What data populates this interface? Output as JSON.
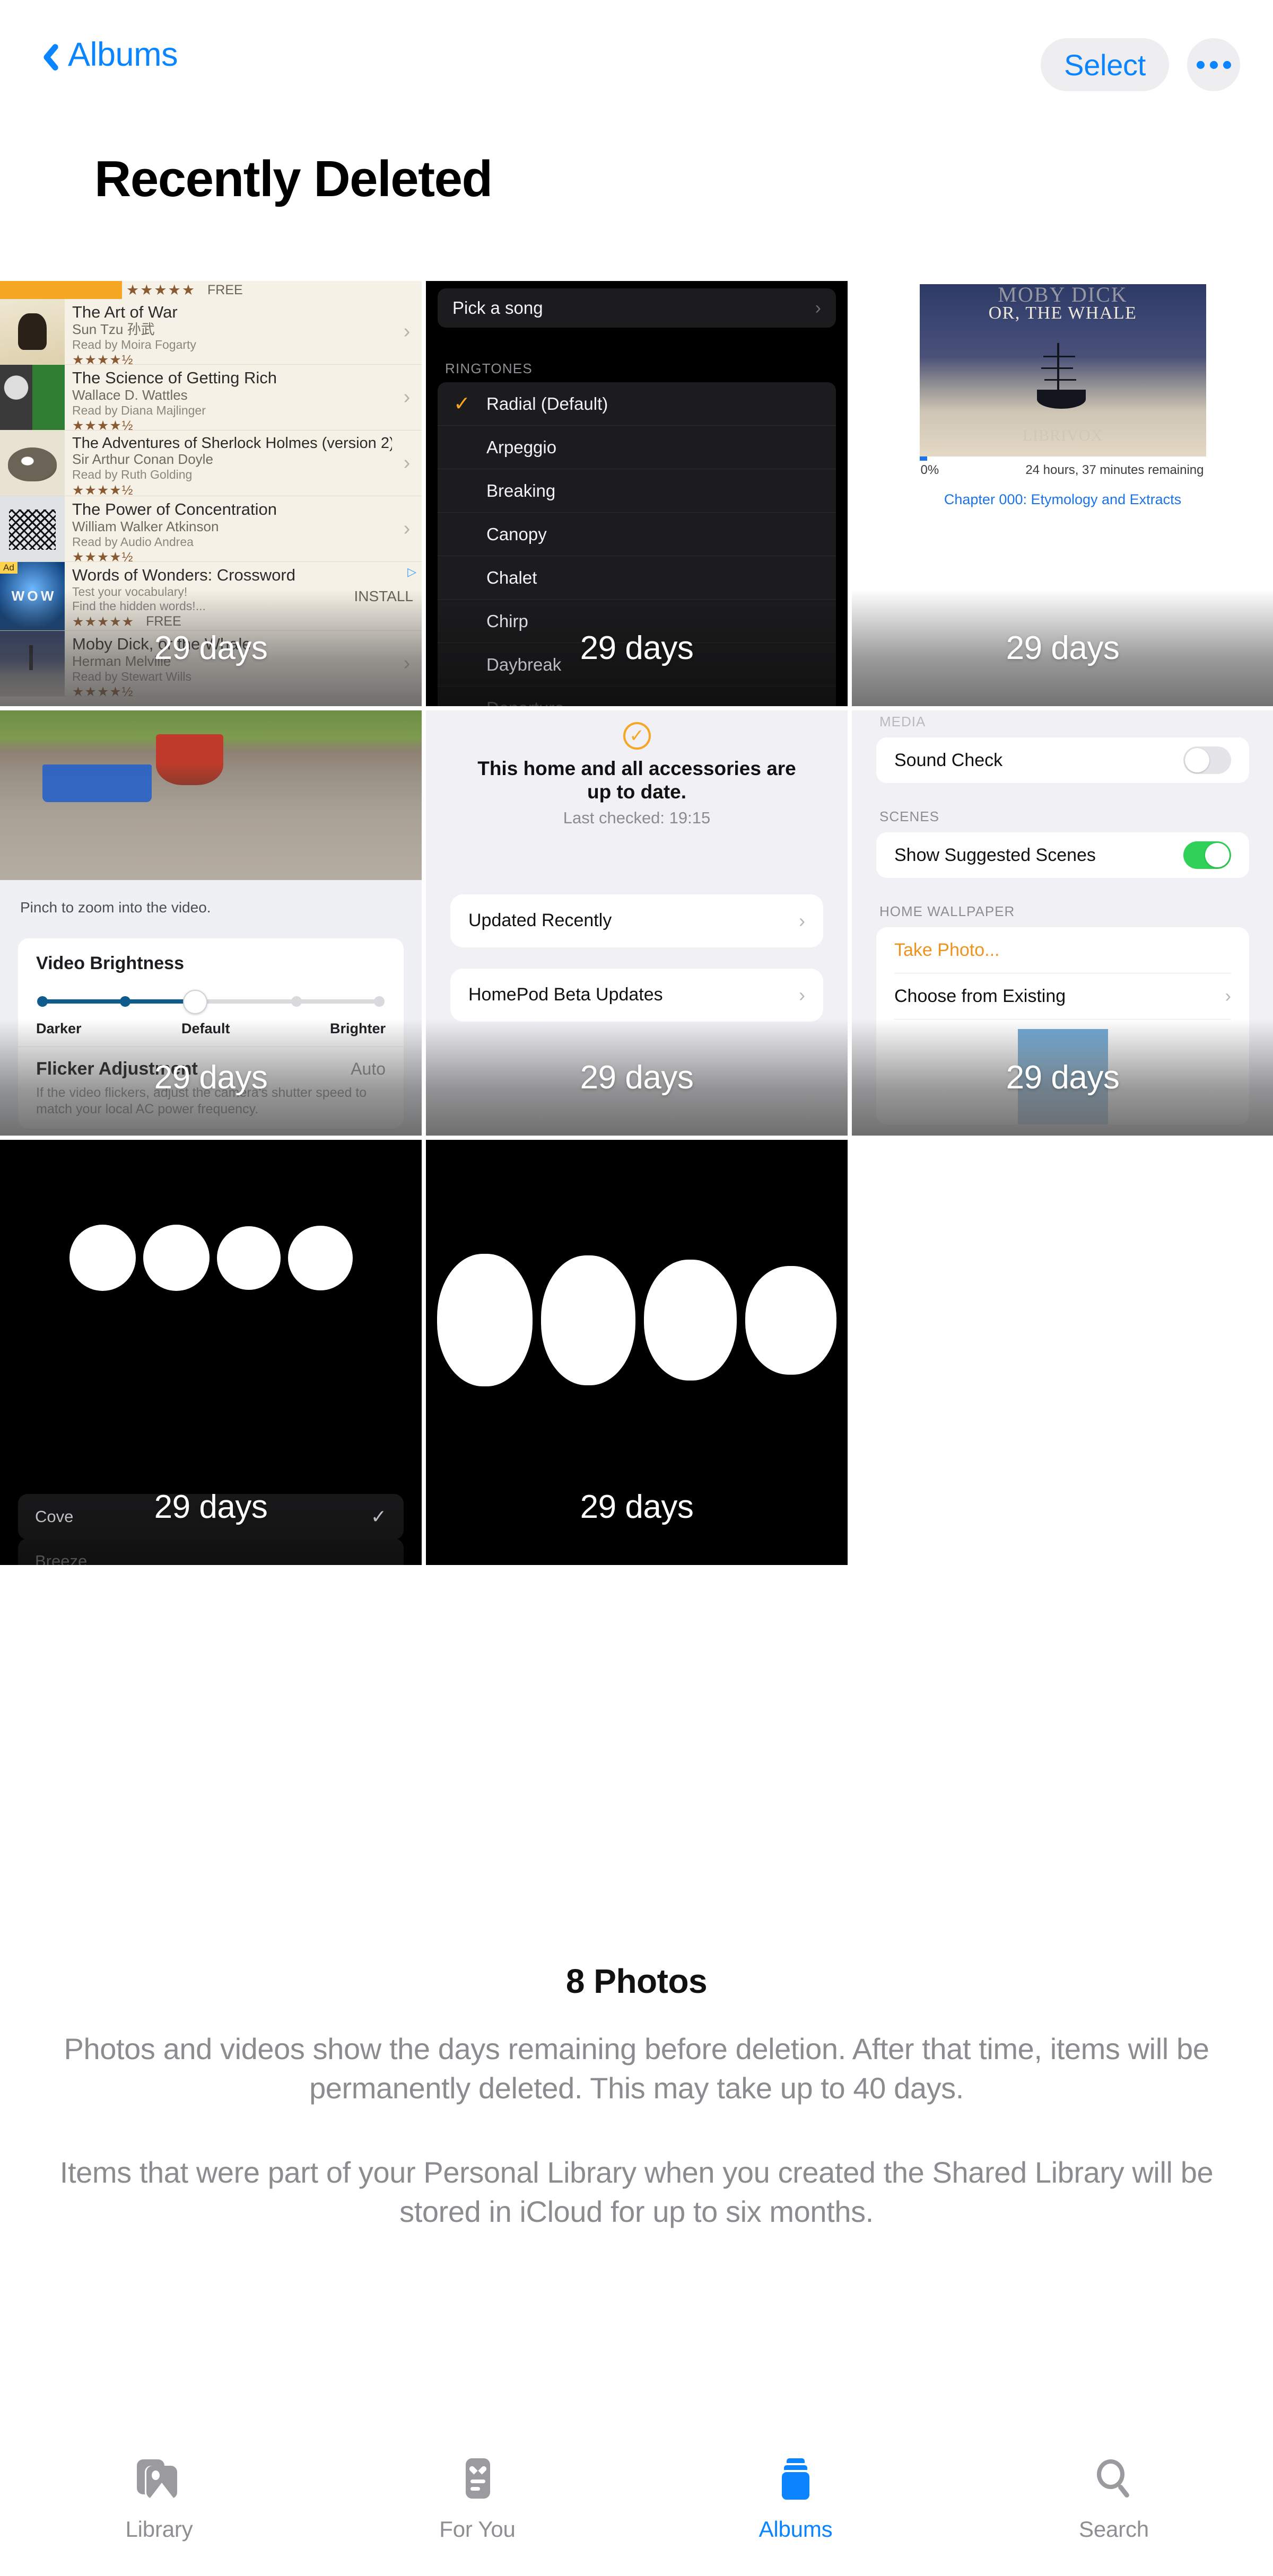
{
  "navbar": {
    "back_label": "Albums",
    "select_label": "Select",
    "more_label": "•••"
  },
  "page_title": "Recently Deleted",
  "grid": {
    "tiles": [
      {
        "id": "audiobooks",
        "days_label": "29 days",
        "kind": "audiobook-list",
        "header": {
          "stars": "★★★★★",
          "free": "FREE"
        },
        "rows": [
          {
            "title": "The Art of War",
            "author": "Sun Tzu 孙武",
            "reader": "Read by Moira Fogarty",
            "stars": "★★★★½"
          },
          {
            "title": "The Science of Getting Rich",
            "author": "Wallace D. Wattles",
            "reader": "Read by Diana Majlinger",
            "stars": "★★★★½"
          },
          {
            "title": "The Adventures of Sherlock Holmes (version 2)",
            "author": "Sir Arthur Conan Doyle",
            "reader": "Read by Ruth Golding",
            "stars": "★★★★½"
          },
          {
            "title": "The Power of Concentration",
            "author": "William Walker Atkinson",
            "reader": "Read by Audio Andrea",
            "stars": "★★★★½"
          }
        ],
        "ad": {
          "tag": "Ad",
          "title": "Words of Wonders: Crossword",
          "line1": "Test your vocabulary!",
          "line2": "Find the hidden words!...",
          "cta": "INSTALL",
          "stars": "★★★★★",
          "free": "FREE"
        },
        "last_row": {
          "title": "Moby Dick, or the Whale",
          "author": "Herman Melville",
          "reader": "Read by Stewart Wills",
          "stars": "★★★★½"
        }
      },
      {
        "id": "ringtones",
        "days_label": "29 days",
        "kind": "ringtone-picker",
        "pick_a_song": "Pick a song",
        "section_label": "RINGTONES",
        "items": [
          {
            "label": "Radial (Default)",
            "selected": true
          },
          {
            "label": "Arpeggio",
            "selected": false
          },
          {
            "label": "Breaking",
            "selected": false
          },
          {
            "label": "Canopy",
            "selected": false
          },
          {
            "label": "Chalet",
            "selected": false
          },
          {
            "label": "Chirp",
            "selected": false
          },
          {
            "label": "Daybreak",
            "selected": false
          },
          {
            "label": "Departure",
            "selected": false
          }
        ]
      },
      {
        "id": "moby-dick-player",
        "days_label": "29 days",
        "kind": "audiobook-player",
        "cover_title_top": "MOBY DICK",
        "cover_title_sub": "OR, THE WHALE",
        "cover_brand": "LIBRIVOX",
        "progress_percent": "0%",
        "time_remaining": "24 hours, 37 minutes remaining",
        "chapter": "Chapter 000: Etymology and Extracts"
      },
      {
        "id": "video-brightness",
        "days_label": "29 days",
        "kind": "video-settings",
        "hint": "Pinch to zoom into the video.",
        "card_title": "Video Brightness",
        "slider": {
          "left": "Darker",
          "center": "Default",
          "right": "Brighter"
        },
        "row2_label": "Flicker Adjustment",
        "row2_value": "Auto",
        "footnote": "If the video flickers, adjust the camera's shutter speed to match your local AC power frequency."
      },
      {
        "id": "home-status",
        "days_label": "29 days",
        "kind": "home-status",
        "status_title": "This home and all accessories are up to date.",
        "last_checked": "Last checked: 19:15",
        "rows": [
          "Updated Recently",
          "HomePod Beta Updates"
        ]
      },
      {
        "id": "home-settings",
        "days_label": "29 days",
        "kind": "home-settings",
        "section_media": "MEDIA",
        "sound_check_label": "Sound Check",
        "sound_check_on": false,
        "section_scenes": "SCENES",
        "suggested_scenes_label": "Show Suggested Scenes",
        "suggested_scenes_on": true,
        "section_wallpaper": "HOME WALLPAPER",
        "take_photo_label": "Take Photo...",
        "choose_existing_label": "Choose from Existing"
      },
      {
        "id": "cove-circles",
        "days_label": "29 days",
        "kind": "dark-circles",
        "chip_label": "Cove",
        "chip_selected": true,
        "chip2_label": "Breeze"
      },
      {
        "id": "ovals",
        "days_label": "29 days",
        "kind": "dark-ovals"
      }
    ]
  },
  "footer": {
    "count": "8 Photos",
    "paragraph1": "Photos and videos show the days remaining before deletion. After that time, items will be permanently deleted. This may take up to 40 days.",
    "paragraph2": "Items that were part of your Personal Library when you created the Shared Library will be stored in iCloud for up to six months."
  },
  "tabbar": {
    "tabs": [
      {
        "label": "Library",
        "icon": "library-icon",
        "active": false
      },
      {
        "label": "For You",
        "icon": "for-you-icon",
        "active": false
      },
      {
        "label": "Albums",
        "icon": "albums-icon",
        "active": true
      },
      {
        "label": "Search",
        "icon": "search-icon",
        "active": false
      }
    ]
  },
  "colors": {
    "accent": "#0a84ff",
    "toggle_on": "#30d158",
    "orange": "#f5a623",
    "muted_text": "#8c8c90"
  }
}
